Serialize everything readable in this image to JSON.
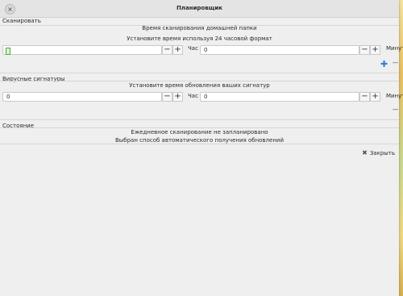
{
  "window": {
    "title": "Планировщик"
  },
  "scan": {
    "section_title": "Сканировать",
    "heading": "Время сканирования домашней папки",
    "subheading": "Установите время используя 24 часовой формат",
    "hour_value": "",
    "hour_unit": "Час",
    "minute_value": "0",
    "minute_unit": "Минута"
  },
  "signatures": {
    "section_title": "Вирусные сигнатуры",
    "subheading": "Установите время обновления ваших сигнатур",
    "hour_value": "0",
    "hour_unit": "Час",
    "minute_value": "0",
    "minute_unit": "Минута"
  },
  "status": {
    "section_title": "Состояние",
    "line1": "Ежедневное сканирование не запланировано",
    "line2": "Выбран способ автоматического получения обновлений"
  },
  "actions": {
    "close_label": "Закрыть"
  },
  "icons": {
    "plus": "plus-icon",
    "minus": "minus-icon",
    "close": "close-icon"
  },
  "colors": {
    "accent": "#3d7dd8"
  }
}
